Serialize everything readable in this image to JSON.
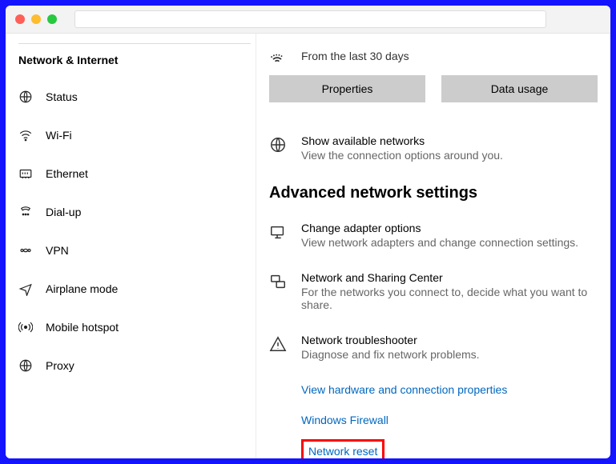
{
  "sidebar": {
    "title": "Network & Internet",
    "items": [
      {
        "label": "Status"
      },
      {
        "label": "Wi-Fi"
      },
      {
        "label": "Ethernet"
      },
      {
        "label": "Dial-up"
      },
      {
        "label": "VPN"
      },
      {
        "label": "Airplane mode"
      },
      {
        "label": "Mobile hotspot"
      },
      {
        "label": "Proxy"
      }
    ]
  },
  "main": {
    "last30": "From the last 30 days",
    "btn_properties": "Properties",
    "btn_datausage": "Data usage",
    "available": {
      "title": "Show available networks",
      "sub": "View the connection options around you."
    },
    "advanced_heading": "Advanced network settings",
    "adapter": {
      "title": "Change adapter options",
      "sub": "View network adapters and change connection settings."
    },
    "sharing": {
      "title": "Network and Sharing Center",
      "sub": "For the networks you connect to, decide what you want to share."
    },
    "troubleshoot": {
      "title": "Network troubleshooter",
      "sub": "Diagnose and fix network problems."
    },
    "links": {
      "hardware": "View hardware and connection properties",
      "firewall": "Windows Firewall",
      "reset": "Network reset"
    }
  }
}
